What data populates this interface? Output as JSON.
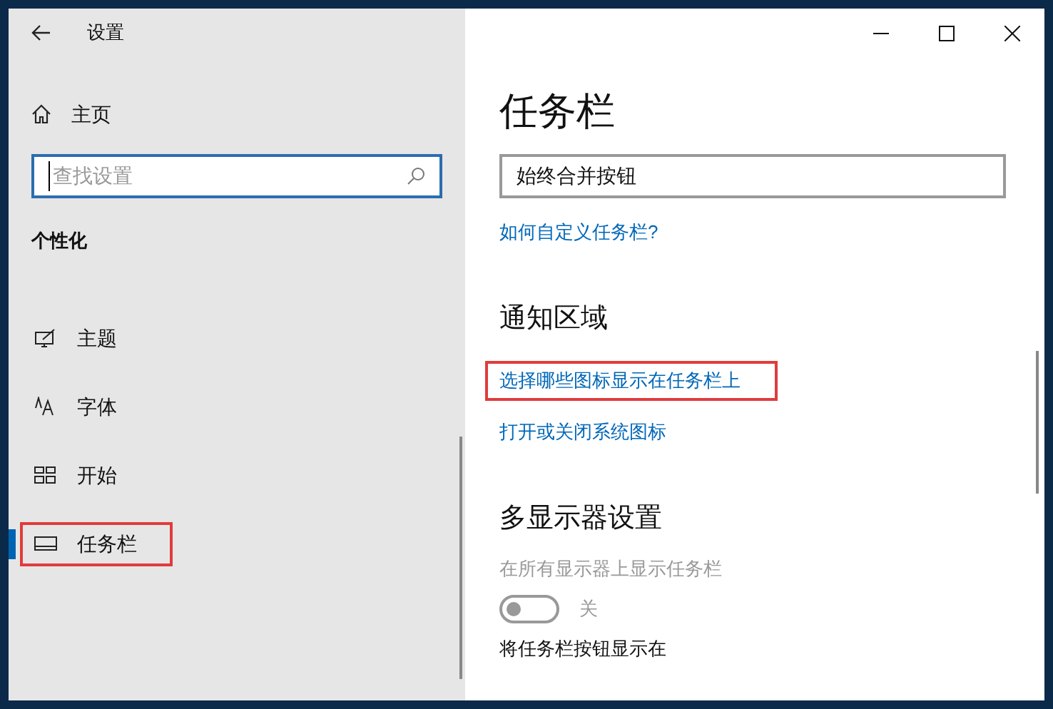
{
  "window": {
    "title": "设置"
  },
  "sidebar": {
    "home": "主页",
    "search": {
      "placeholder": "查找设置"
    },
    "section": "个性化",
    "items": [
      {
        "label": "主题",
        "selected": false,
        "highlighted": false
      },
      {
        "label": "字体",
        "selected": false,
        "highlighted": false
      },
      {
        "label": "开始",
        "selected": false,
        "highlighted": false
      },
      {
        "label": "任务栏",
        "selected": true,
        "highlighted": true
      }
    ]
  },
  "content": {
    "title": "任务栏",
    "combo_value": "始终合并按钮",
    "blocks": [
      {
        "kind": "link",
        "text": "如何自定义任务栏?",
        "highlighted": false
      },
      {
        "kind": "heading",
        "text": "通知区域"
      },
      {
        "kind": "link",
        "text": "选择哪些图标显示在任务栏上",
        "highlighted": true
      },
      {
        "kind": "link",
        "text": "打开或关闭系统图标",
        "highlighted": false
      },
      {
        "kind": "heading",
        "text": "多显示器设置"
      },
      {
        "kind": "toggle",
        "label": "在所有显示器上显示任务栏",
        "on": false,
        "disabled": true,
        "state_text": "关"
      },
      {
        "kind": "label",
        "text": "将任务栏按钮显示在"
      }
    ]
  }
}
